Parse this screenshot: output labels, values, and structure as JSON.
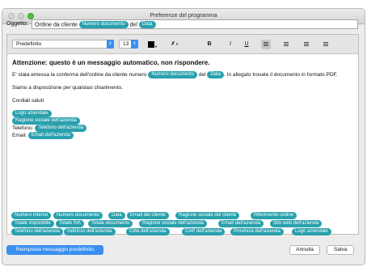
{
  "window": {
    "title": "Preferenze del programma"
  },
  "subject": {
    "label": "Oggetto:",
    "text_1": "Ordine da cliente",
    "tag_1": "Numero documento",
    "text_2": "del",
    "tag_2": "Data"
  },
  "toolbar": {
    "font": "Predefinito",
    "size": "13",
    "bold": "B",
    "italic": "I",
    "underline": "U"
  },
  "body": {
    "heading": "Attenzione: questo è un messaggio automatico, non rispondere.",
    "p1_a": "E' stata emessa la conferma dell'ordine da cliente numero",
    "p1_tag1": "Numero documento",
    "p1_b": "del",
    "p1_tag2": "Data",
    "p1_c": ". In allegato trovate il documento in formato PDF.",
    "p2": "Siamo a disposizione per qualsiasi chiarimento.",
    "p3": "Cordiali saluti",
    "sig_logo": "Logo aziendale",
    "sig_company": "Ragione sociale dell'azienda",
    "phone_label": "Telefono:",
    "phone_tag": "Telefono dell'azienda",
    "email_label": "Email:",
    "email_tag": "Email dell'azienda"
  },
  "tags": [
    "Numero interno",
    "Numero documento",
    "Data",
    "Email del cliente",
    "Ragione sociale del cliente",
    "Riferimento ordine",
    "Totale imponibile",
    "Totale IVA",
    "Totale documento",
    "Ragione sociale dell'azienda",
    "Email dell'azienda",
    "Sito web dell'azienda",
    "Telefono dell'azienda",
    "Indirizzo dell'azienda",
    "Città dell'azienda",
    "CAP dell'azienda",
    "Provincia dell'azienda",
    "Logo aziendale"
  ],
  "buttons": {
    "reset": "Reimposta messaggio predefinito",
    "cancel": "Annulla",
    "save": "Salva"
  }
}
